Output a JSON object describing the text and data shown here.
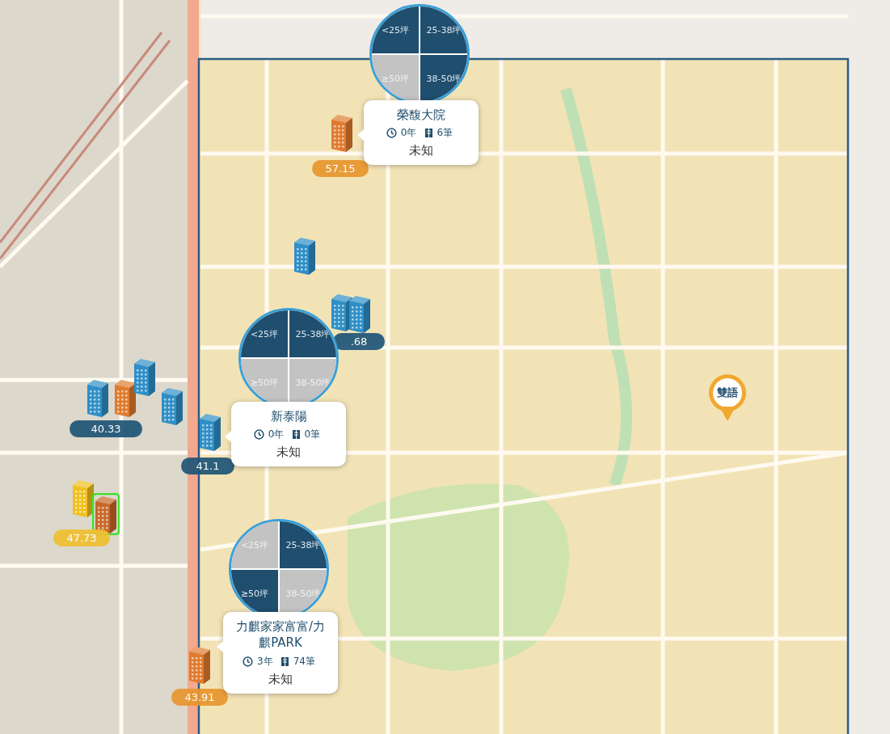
{
  "clusters": [
    {
      "quadrants": [
        {
          "label": "<25坪",
          "selected": true
        },
        {
          "label": "25-38坪",
          "selected": true
        },
        {
          "label": "≥50坪",
          "selected": false
        },
        {
          "label": "38-50坪",
          "selected": true
        }
      ],
      "popup": {
        "name": "榮馥大院",
        "age": "0年",
        "count": "6筆",
        "status": "未知"
      },
      "price": {
        "value": "57.15",
        "color": "#e8962e"
      },
      "building": {
        "color": "#e07b2e"
      }
    },
    {
      "quadrants": [
        {
          "label": "<25坪",
          "selected": true
        },
        {
          "label": "25-38坪",
          "selected": true
        },
        {
          "label": "≥50坪",
          "selected": false
        },
        {
          "label": "38-50坪",
          "selected": false
        }
      ],
      "popup": {
        "name": "新泰陽",
        "age": "0年",
        "count": "0筆",
        "status": "未知"
      },
      "price": {
        "value": "41.1",
        "color": "#1f5577"
      },
      "building": {
        "color": "#2f8fc7"
      }
    },
    {
      "quadrants": [
        {
          "label": "<25坪",
          "selected": false
        },
        {
          "label": "25-38坪",
          "selected": true
        },
        {
          "label": "≥50坪",
          "selected": true
        },
        {
          "label": "38-50坪",
          "selected": false
        }
      ],
      "popup": {
        "name": "力麒家家富富/力麒PARK",
        "age": "3年",
        "count": "74筆",
        "status": "未知"
      },
      "price": {
        "value": "43.91",
        "color": "#e8962e"
      },
      "building": {
        "color": "#e07b2e"
      }
    }
  ],
  "markers": [
    {
      "value": ".68",
      "color": "#1f5577",
      "buildings": [
        {
          "color": "#2f8fc7",
          "highlighted": false
        },
        {
          "color": "#2f8fc7",
          "highlighted": false
        }
      ]
    },
    {
      "value": "40.33",
      "color": "#1f5577",
      "buildings": [
        {
          "color": "#2f8fc7",
          "highlighted": false
        },
        {
          "color": "#e07b2e",
          "highlighted": false
        }
      ]
    },
    {
      "value": "47.73",
      "color": "#f0c030",
      "buildings": [
        {
          "color": "#f0c020",
          "highlighted": false
        },
        {
          "color": "#c8682a",
          "highlighted": true
        }
      ]
    }
  ],
  "pin": {
    "label": "雙語"
  }
}
